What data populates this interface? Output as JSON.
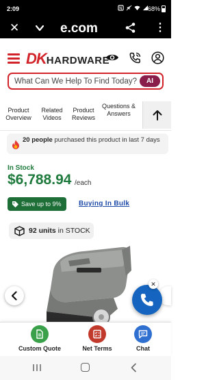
{
  "status_bar": {
    "time": "2:09",
    "battery": "68%"
  },
  "browser": {
    "url_fragment": "e.com"
  },
  "header": {
    "logo_dk": "DK",
    "logo_rest": "HARDWARE"
  },
  "search": {
    "placeholder": "What Can We Help To Find Today?",
    "ai_label": "AI"
  },
  "tabs": [
    {
      "label": "Product Overview"
    },
    {
      "label": "Related Videos"
    },
    {
      "label": "Product Reviews"
    },
    {
      "label": "Questions & Answers"
    }
  ],
  "purchased": {
    "count": "20 people",
    "text": " purchased this product in last 7 days"
  },
  "stock_status": "In Stock",
  "price": {
    "amount": "$6,788.94",
    "unit": "/each"
  },
  "save_badge": "Save up to 9%",
  "bulk_link": "Buying In Bulk",
  "units": {
    "count": "92 units",
    "text": " in STOCK"
  },
  "actions": [
    {
      "label": "Custom Quote",
      "color": "#3aa14a",
      "icon": "document-icon"
    },
    {
      "label": "Net Terms",
      "color": "#c0392b",
      "icon": "checklist-icon"
    },
    {
      "label": "Chat",
      "color": "#2f6fd0",
      "icon": "chat-icon"
    }
  ],
  "colors": {
    "brand_red": "#d2232a",
    "price_green": "#1e7a3c",
    "link_blue": "#1d4aa8",
    "fab_blue": "#1565c0"
  }
}
